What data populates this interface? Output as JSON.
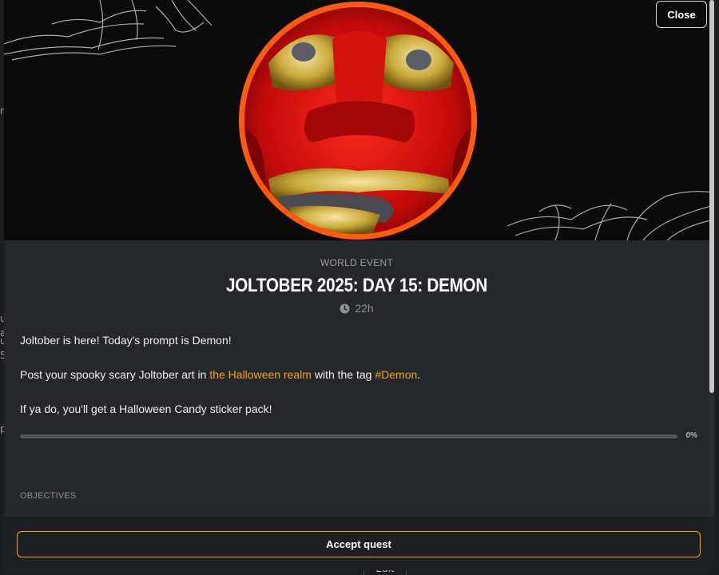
{
  "background": {
    "edit_label": "Edit",
    "left_glyphs": [
      "re",
      "u",
      "a",
      "u",
      "5",
      "p"
    ]
  },
  "modal": {
    "close_label": "Close",
    "kicker": "WORLD EVENT",
    "title": "JOLTOBER 2025: DAY 15: DEMON",
    "timer": "22h",
    "description": {
      "line1": "Joltober is here! Today's prompt is Demon!",
      "line2_prefix": "Post your spooky scary Joltober art in ",
      "line2_link": "the Halloween realm",
      "line2_middle": " with the tag ",
      "line2_tag": "#Demon",
      "line2_suffix": ".",
      "line3": "If ya do, you'll get a Halloween Candy sticker pack!"
    },
    "progress": {
      "value": 0,
      "label": "0%"
    },
    "objectives_heading": "OBJECTIVES",
    "accept_label": "Accept quest"
  },
  "colors": {
    "accent": "#f0a419",
    "ring": "#ff5a0e",
    "modal_bg": "#26272b",
    "hero_bg": "#0b0b0c"
  },
  "icons": {
    "close": "close-button",
    "clock": "clock-icon",
    "hero": "demon-mask-avatar"
  }
}
